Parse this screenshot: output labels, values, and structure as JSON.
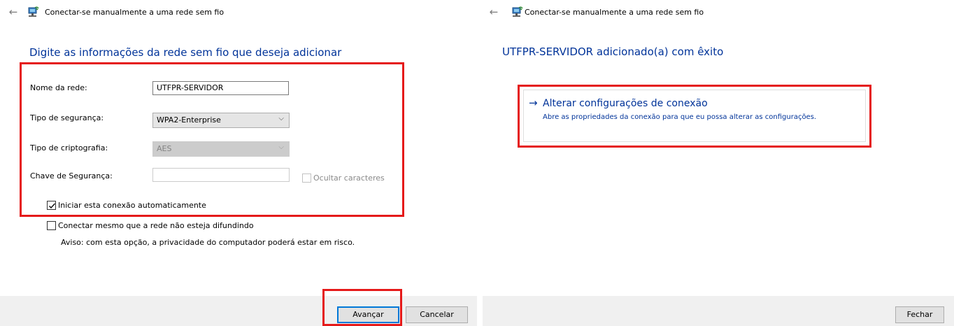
{
  "left": {
    "title": "Conectar-se manualmente a uma rede sem fio",
    "heading": "Digite as informações da rede sem fio que deseja adicionar",
    "network_name_label": "Nome da rede:",
    "network_name_value": "UTFPR-SERVIDOR",
    "security_type_label": "Tipo de segurança:",
    "security_type_value": "WPA2-Enterprise",
    "encryption_type_label": "Tipo de criptografia:",
    "encryption_type_value": "AES",
    "security_key_label": "Chave de Segurança:",
    "security_key_value": "",
    "hide_chars_label": "Ocultar caracteres",
    "hide_chars_checked": false,
    "auto_connect_label": "Iniciar esta conexão automaticamente",
    "auto_connect_checked": true,
    "connect_even_label": "Conectar mesmo que a rede não esteja difundindo",
    "connect_even_checked": false,
    "warning_text": "Aviso: com esta opção, a privacidade do computador poderá estar em risco.",
    "next_button": "Avançar",
    "cancel_button": "Cancelar"
  },
  "right": {
    "title": "Conectar-se manualmente a uma rede sem fio",
    "heading": "UTFPR-SERVIDOR adicionado(a) com êxito",
    "link_arrow": "→",
    "link_title": "Alterar configurações de conexão",
    "link_description": "Abre as propriedades da conexão para que eu possa alterar as configurações.",
    "close_button": "Fechar"
  },
  "icons": {
    "back": "←",
    "dropdown": "⌵"
  },
  "colors": {
    "heading": "#003399",
    "highlight_border": "#e51a1a",
    "default_button_border": "#0078d7",
    "footer_bg": "#f0f0f0"
  }
}
